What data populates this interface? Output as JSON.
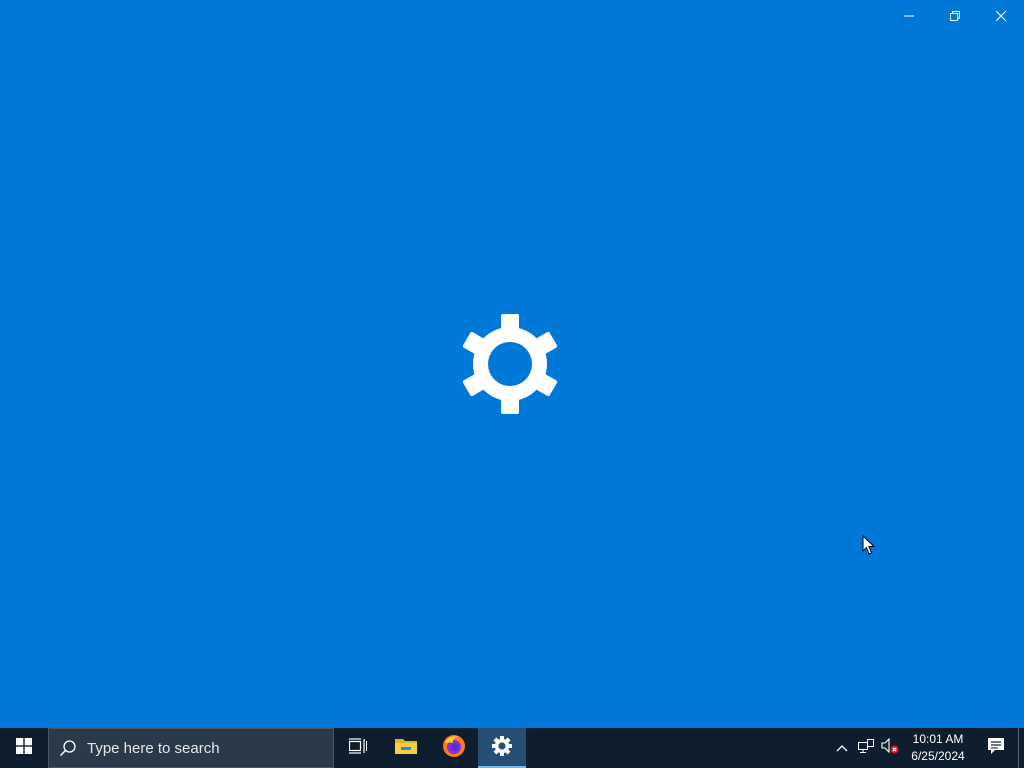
{
  "window": {
    "app": "Settings",
    "background_color": "#0078d7",
    "splash_icon": "gear-icon",
    "caption_buttons": {
      "minimize_icon": "minimize-icon",
      "restore_icon": "restore-icon",
      "close_icon": "close-icon"
    }
  },
  "taskbar": {
    "background_color": "#0f1e2e",
    "start_icon": "windows-logo-icon",
    "search": {
      "placeholder": "Type here to search",
      "icon": "search-icon"
    },
    "buttons": [
      {
        "name": "Task View",
        "icon": "task-view-icon"
      },
      {
        "name": "File Explorer",
        "icon": "folder-icon"
      },
      {
        "name": "Firefox",
        "icon": "firefox-icon"
      },
      {
        "name": "Settings",
        "icon": "gear-icon",
        "active": true
      }
    ],
    "tray": {
      "icons": [
        "chevron-up-icon",
        "network-icon",
        "volume-muted-icon"
      ],
      "time": "10:01 AM",
      "date": "6/25/2024",
      "notification_icon": "action-center-icon"
    }
  }
}
